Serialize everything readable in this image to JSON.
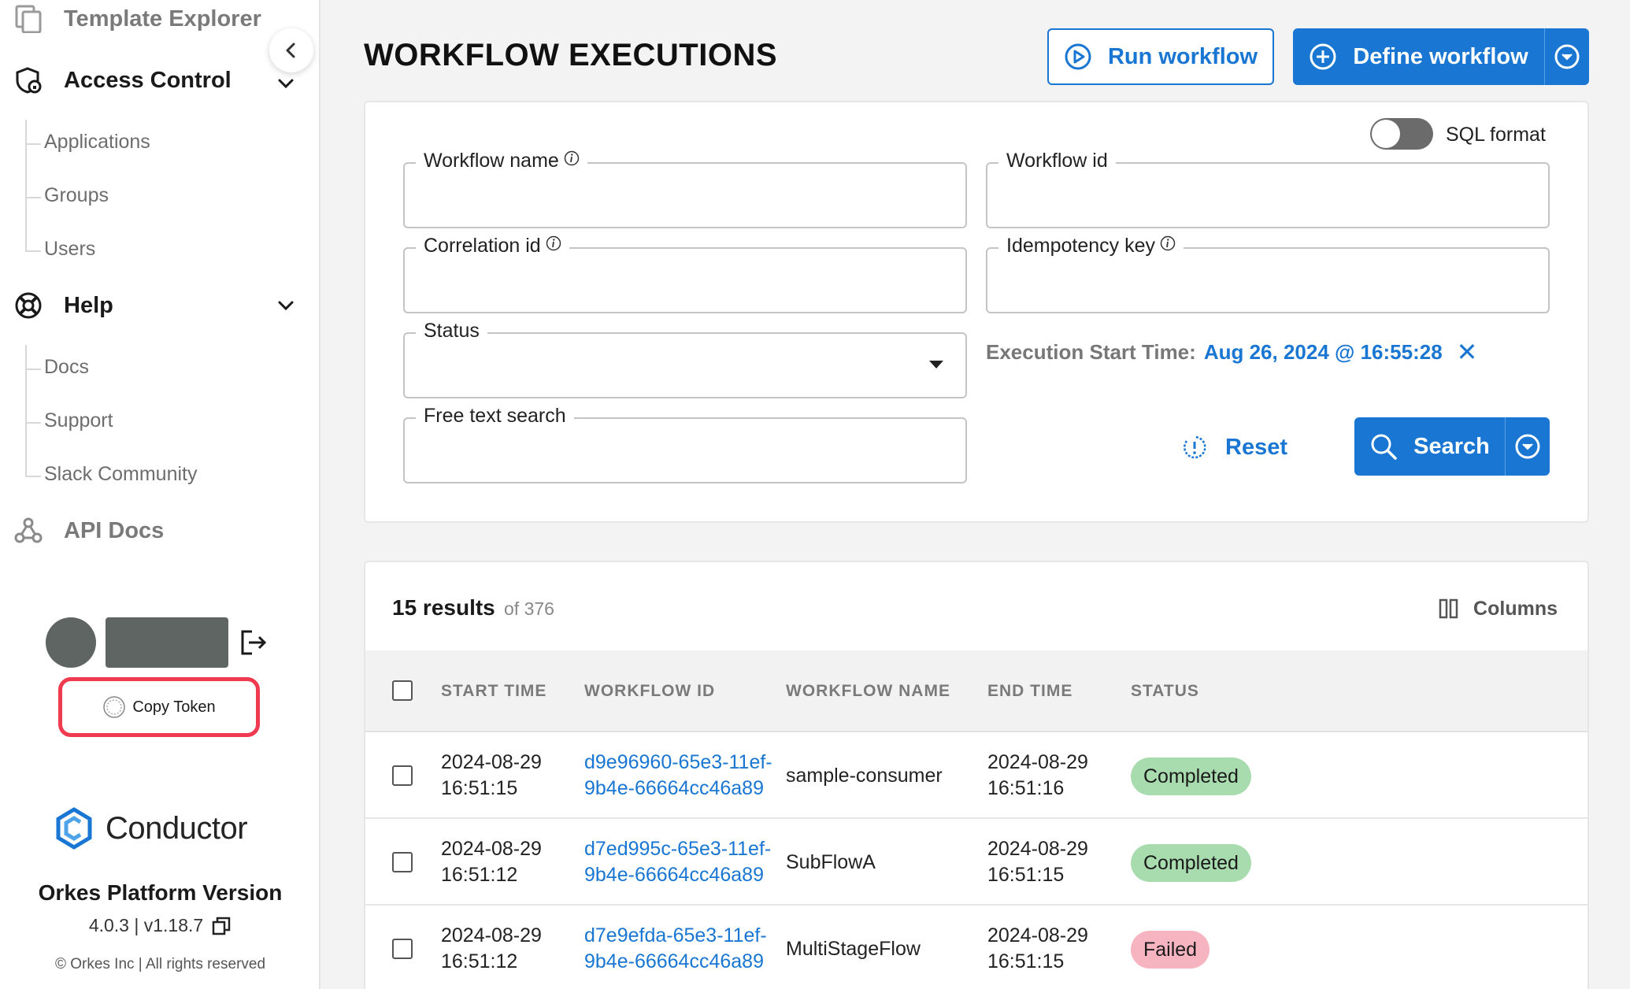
{
  "sidebar": {
    "template_explorer": "Template Explorer",
    "access_control": {
      "label": "Access Control",
      "items": [
        "Applications",
        "Groups",
        "Users"
      ]
    },
    "help": {
      "label": "Help",
      "items": [
        "Docs",
        "Support",
        "Slack Community"
      ]
    },
    "api_docs": "API Docs",
    "copy_token": "Copy Token",
    "brand_name": "Conductor",
    "version_title": "Orkes Platform Version",
    "version_number": "4.0.3 | v1.18.7",
    "copyright": "© Orkes Inc | All rights reserved"
  },
  "header": {
    "title": "WORKFLOW EXECUTIONS",
    "run_workflow": "Run workflow",
    "define_workflow": "Define workflow"
  },
  "filters": {
    "sql_format_label": "SQL format",
    "sql_format_on": false,
    "workflow_name": {
      "label": "Workflow name",
      "value": ""
    },
    "workflow_id": {
      "label": "Workflow id",
      "value": ""
    },
    "correlation_id": {
      "label": "Correlation id",
      "value": ""
    },
    "idempotency_key": {
      "label": "Idempotency key",
      "value": ""
    },
    "status": {
      "label": "Status",
      "value": ""
    },
    "free_text": {
      "label": "Free text search",
      "value": ""
    },
    "execution_start_time": {
      "label": "Execution Start Time:",
      "value": "Aug 26, 2024 @ 16:55:28",
      "clear": "✕"
    },
    "reset": "Reset",
    "search": "Search"
  },
  "results": {
    "count": "15 results",
    "of_total": "of 376",
    "columns_label": "Columns",
    "headers": [
      "START TIME",
      "WORKFLOW ID",
      "WORKFLOW NAME",
      "END TIME",
      "STATUS"
    ],
    "rows": [
      {
        "start_date": "2024-08-29",
        "start_time": "16:51:15",
        "id_1": "d9e96960-65e3-11ef-",
        "id_2": "9b4e-66664cc46a89",
        "name": "sample-consumer",
        "end_date": "2024-08-29",
        "end_time": "16:51:16",
        "status": "Completed"
      },
      {
        "start_date": "2024-08-29",
        "start_time": "16:51:12",
        "id_1": "d7ed995c-65e3-11ef-",
        "id_2": "9b4e-66664cc46a89",
        "name": "SubFlowA",
        "end_date": "2024-08-29",
        "end_time": "16:51:15",
        "status": "Completed"
      },
      {
        "start_date": "2024-08-29",
        "start_time": "16:51:12",
        "id_1": "d7e9efda-65e3-11ef-",
        "id_2": "9b4e-66664cc46a89",
        "name": "MultiStageFlow",
        "end_date": "2024-08-29",
        "end_time": "16:51:15",
        "status": "Failed"
      }
    ]
  },
  "colors": {
    "accent": "#1976d2",
    "completed_bg": "#a8dcae",
    "failed_bg": "#f6b3c0",
    "highlight": "#ef3a4f"
  }
}
